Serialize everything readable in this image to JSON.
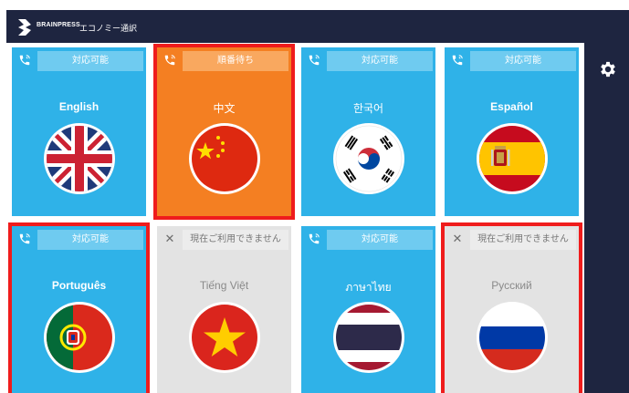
{
  "header": {
    "brand": "BRAINPRESS",
    "title": "エコノミー通訳"
  },
  "sidebar": {
    "settings_icon": "gear-icon"
  },
  "colors": {
    "available": "#2fb2e8",
    "queue": "#f47f22",
    "unavailable": "#e3e3e3",
    "selection": "#ef1c1c",
    "navy": "#1e2540"
  },
  "tiles": [
    {
      "status": "対応可能",
      "language": "English",
      "state": "available",
      "selected": false
    },
    {
      "status": "順番待ち",
      "language": "中文",
      "state": "queue",
      "selected": true
    },
    {
      "status": "対応可能",
      "language": "한국어",
      "state": "available",
      "selected": false
    },
    {
      "status": "対応可能",
      "language": "Español",
      "state": "available",
      "selected": false
    },
    {
      "status": "対応可能",
      "language": "Português",
      "state": "available",
      "selected": true
    },
    {
      "status": "現在ご利用できません",
      "language": "Tiếng Việt",
      "state": "unavailable",
      "selected": false
    },
    {
      "status": "対応可能",
      "language": "ภาษาไทย",
      "state": "available",
      "selected": false
    },
    {
      "status": "現在ご利用できません",
      "language": "Русский",
      "state": "unavailable",
      "selected": true
    }
  ]
}
